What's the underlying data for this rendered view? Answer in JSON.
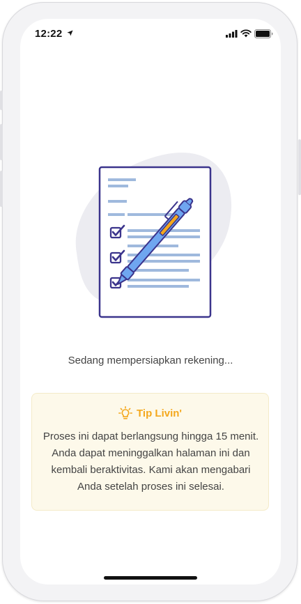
{
  "status_bar": {
    "time": "12:22",
    "location_icon": "location-arrow-icon",
    "signal_icon": "cellular-signal-icon",
    "wifi_icon": "wifi-icon",
    "battery_icon": "battery-icon"
  },
  "illustration": {
    "icon": "document-checklist-with-pen-illustration"
  },
  "status_message": "Sedang mempersiapkan rekening...",
  "tip": {
    "icon": "lightbulb-icon",
    "title": "Tip Livin'",
    "body": "Proses ini dapat berlangsung hingga 15 menit. Anda dapat meninggalkan halaman ini dan kembali beraktivitas. Kami akan mengabari Anda setelah proses ini selesai."
  },
  "colors": {
    "tip_accent": "#f4a81d",
    "tip_background": "#fdf9ea",
    "document_outline": "#3b348c",
    "pen_blue": "#6fa6f0",
    "line_blue": "#9fb9dd",
    "blob_gray": "#ececf1"
  }
}
